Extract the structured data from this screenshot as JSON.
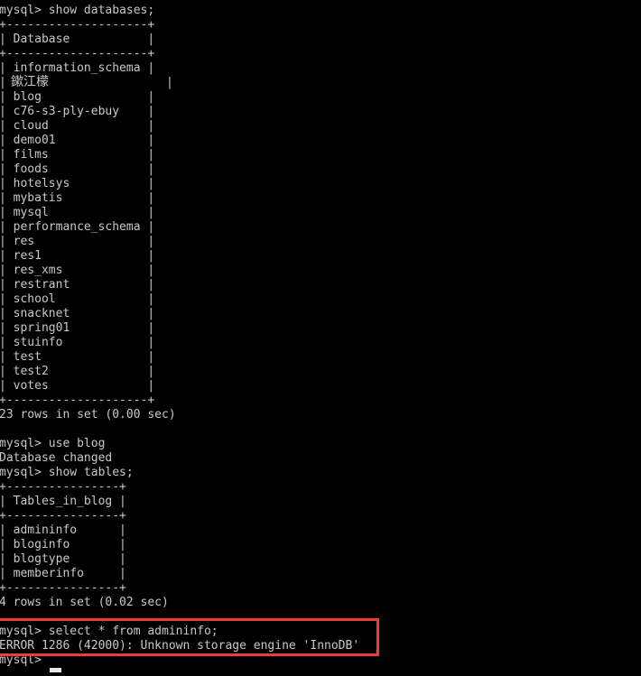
{
  "terminal": {
    "title": "mysql-client-terminal",
    "colors": {
      "background": "#000000",
      "foreground": "#c8c8c8",
      "highlight": "#ef3b34",
      "cursor": "#e8e8e8"
    },
    "prompt": "mysql> ",
    "lines": [
      "mysql> show databases;",
      "+--------------------+",
      "| Database           |",
      "+--------------------+",
      "| information_schema |",
      "| blog               |",
      "| c76-s3-ply-ebuy    |",
      "| cloud              |",
      "| demo01             |",
      "| films              |",
      "| foods              |",
      "| hotelsys           |",
      "| mybatis            |",
      "| mysql              |",
      "| performance_schema |",
      "| res                |",
      "| res1               |",
      "| res_xms            |",
      "| restrant           |",
      "| school             |",
      "| snacknet           |",
      "| spring01           |",
      "| stuinfo            |",
      "| test               |",
      "| test2              |",
      "| votes              |",
      "+--------------------+",
      "23 rows in set (0.00 sec)",
      "",
      "mysql> use blog",
      "Database changed",
      "mysql> show tables;",
      "+----------------+",
      "| Tables_in_blog |",
      "+----------------+",
      "| admininfo      |",
      "| bloginfo       |",
      "| blogtype       |",
      "| memberinfo     |",
      "+----------------+",
      "4 rows in set (0.02 sec)",
      "",
      "mysql> select * from admininfo;",
      "ERROR 1286 (42000): Unknown storage engine 'InnoDB'",
      "mysql> "
    ],
    "garbled_row": {
      "glyphs": "鏉江檬",
      "left_pipe": "|",
      "right_pipe": "|",
      "note": "mojibake-database-name"
    },
    "commands": [
      "show databases;",
      "use blog",
      "show tables;",
      "select * from admininfo;"
    ],
    "databases": [
      "information_schema",
      "鏉江檬",
      "blog",
      "c76-s3-ply-ebuy",
      "cloud",
      "demo01",
      "films",
      "foods",
      "hotelsys",
      "mybatis",
      "mysql",
      "performance_schema",
      "res",
      "res1",
      "res_xms",
      "restrant",
      "school",
      "snacknet",
      "spring01",
      "stuinfo",
      "test",
      "test2",
      "votes"
    ],
    "databases_header": "Database",
    "databases_result": "23 rows in set (0.00 sec)",
    "tables_header": "Tables_in_blog",
    "tables": [
      "admininfo",
      "bloginfo",
      "blogtype",
      "memberinfo"
    ],
    "tables_result": "4 rows in set (0.02 sec)",
    "database_changed_message": "Database changed",
    "error_message": "ERROR 1286 (42000): Unknown storage engine 'InnoDB'",
    "error_code": "1286",
    "sqlstate": "42000",
    "engine": "InnoDB"
  }
}
